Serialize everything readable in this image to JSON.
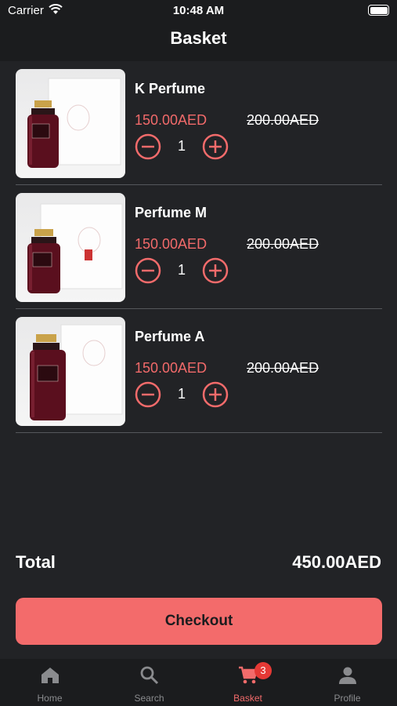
{
  "status_bar": {
    "carrier": "Carrier",
    "time": "10:48 AM"
  },
  "header": {
    "title": "Basket"
  },
  "cart": {
    "items": [
      {
        "name": "K Perfume",
        "price": "150.00AED",
        "old_price": "200.00AED",
        "quantity": "1"
      },
      {
        "name": "Perfume M",
        "price": "150.00AED",
        "old_price": "200.00AED",
        "quantity": "1"
      },
      {
        "name": "Perfume A",
        "price": "150.00AED",
        "old_price": "200.00AED",
        "quantity": "1"
      }
    ]
  },
  "summary": {
    "total_label": "Total",
    "total_value": "450.00AED"
  },
  "checkout": {
    "label": "Checkout"
  },
  "tabbar": {
    "tabs": [
      {
        "label": "Home",
        "icon": "home-icon"
      },
      {
        "label": "Search",
        "icon": "search-icon"
      },
      {
        "label": "Basket",
        "icon": "cart-icon",
        "badge": "3",
        "active": true
      },
      {
        "label": "Profile",
        "icon": "profile-icon"
      }
    ]
  },
  "colors": {
    "background": "#222326",
    "header": "#1b1c1e",
    "accent": "#f36b6b",
    "badge": "#e53935",
    "inactive": "#8a8b8e"
  }
}
